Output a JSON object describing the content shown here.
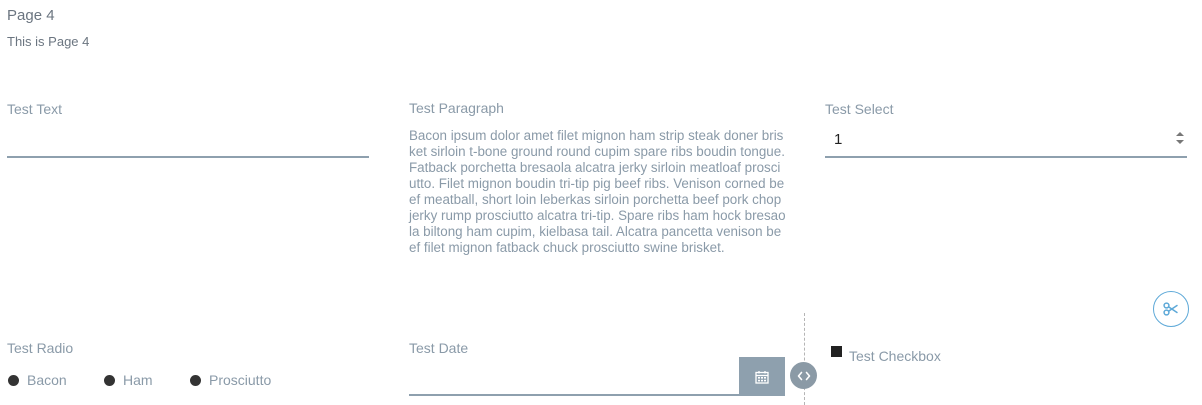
{
  "page": {
    "title": "Page 4",
    "subtitle": "This is Page 4"
  },
  "fields": {
    "text": {
      "label": "Test Text",
      "value": ""
    },
    "paragraph": {
      "label": "Test Paragraph",
      "text": "Bacon ipsum dolor amet filet mignon ham strip steak doner brisket sirloin t-bone ground round cupim spare ribs boudin tongue. Fatback porchetta bresaola alcatra jerky sirloin meatloaf prosciutto. Filet mignon boudin tri-tip pig beef ribs. Venison corned beef meatball, short loin leberkas sirloin porchetta beef pork chop jerky rump prosciutto alcatra tri-tip. Spare ribs ham hock bresaola biltong ham cupim, kielbasa tail. Alcatra pancetta venison beef filet mignon fatback chuck prosciutto swine brisket."
    },
    "select": {
      "label": "Test Select",
      "value": "1"
    },
    "radio": {
      "label": "Test Radio",
      "options": [
        "Bacon",
        "Ham",
        "Prosciutto"
      ]
    },
    "date": {
      "label": "Test Date",
      "value": ""
    },
    "checkbox": {
      "label": "Test Checkbox",
      "checked": true
    }
  },
  "icons": {
    "cut": "scissors-icon",
    "calendar": "calendar-icon",
    "splitter": "code-arrows-icon"
  },
  "colors": {
    "label": "#8a9aa8",
    "underline": "#8ea0ae",
    "accent": "#5ea9d8"
  }
}
